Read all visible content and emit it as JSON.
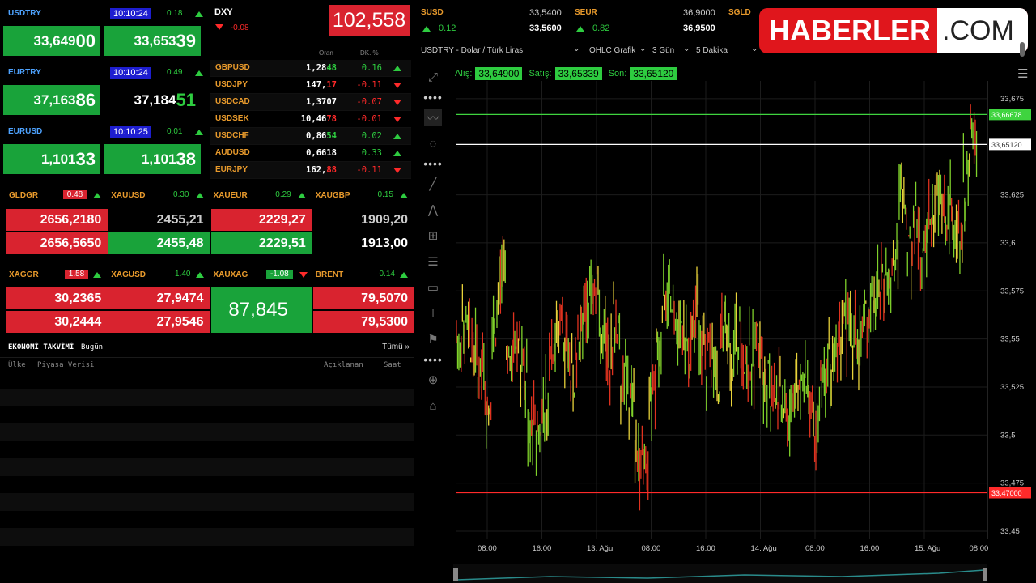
{
  "fx": [
    {
      "name": "USDTRY",
      "time": "10:10:24",
      "change": "0.18",
      "bid_big": "33,649",
      "bid_small": "00",
      "ask_big": "33,653",
      "ask_small": "39",
      "bid_color": "green",
      "ask_color": "green"
    },
    {
      "name": "EURTRY",
      "time": "10:10:24",
      "change": "0.49",
      "bid_big": "37,163",
      "bid_small": "86",
      "ask_big": "37,184",
      "ask_small": "51",
      "bid_color": "green",
      "ask_color": "black"
    },
    {
      "name": "EURUSD",
      "time": "10:10:25",
      "change": "0.01",
      "bid_big": "1,101",
      "bid_small": "33",
      "ask_big": "1,101",
      "ask_small": "38",
      "bid_color": "green",
      "ask_color": "green"
    }
  ],
  "dxy": {
    "name": "DXY",
    "change": "-0.08",
    "value": "102,558"
  },
  "quotes_header": {
    "rate": "Oran",
    "change": "DK. %"
  },
  "quotes": [
    {
      "name": "GBPUSD",
      "rate_a": "1,28",
      "rate_b": "48",
      "change": "0.16",
      "dir": "up"
    },
    {
      "name": "USDJPY",
      "rate_a": "147,",
      "rate_b": "17",
      "change": "-0.11",
      "dir": "dn"
    },
    {
      "name": "USDCAD",
      "rate_a": "1,3707",
      "rate_b": "",
      "change": "-0.07",
      "dir": "dn"
    },
    {
      "name": "USDSEK",
      "rate_a": "10,46",
      "rate_b": "78",
      "change": "-0.01",
      "dir": "dn"
    },
    {
      "name": "USDCHF",
      "rate_a": "0,86",
      "rate_b": "54",
      "change": "0.02",
      "dir": "up"
    },
    {
      "name": "AUDUSD",
      "rate_a": "0,6618",
      "rate_b": "",
      "change": "0.33",
      "dir": "up"
    },
    {
      "name": "EURJPY",
      "rate_a": "162,",
      "rate_b": "88",
      "change": "-0.11",
      "dir": "dn"
    }
  ],
  "metals_row1": [
    {
      "name": "GLDGR",
      "change": "0.48",
      "change_bg": "red",
      "top": "2656,2180",
      "bottom": "2656,5650",
      "top_color": "red",
      "bottom_color": "red"
    },
    {
      "name": "XAUUSD",
      "change": "0.30",
      "change_bg": "",
      "top": "2455,21",
      "bottom": "2455,48",
      "top_color": "black",
      "bottom_color": "green"
    },
    {
      "name": "XAUEUR",
      "change": "0.29",
      "change_bg": "",
      "top": "2229,27",
      "bottom": "2229,51",
      "top_color": "red",
      "bottom_color": "green"
    },
    {
      "name": "XAUGBP",
      "change": "0.15",
      "change_bg": "",
      "top": "1909,20",
      "bottom": "1913,00",
      "top_color": "black",
      "bottom_color": "black"
    }
  ],
  "metals_row2": [
    {
      "name": "XAGGR",
      "change": "1.58",
      "top": "30,2365",
      "bottom": "30,2444"
    },
    {
      "name": "XAGUSD",
      "change": "1.40",
      "top": "27,9474",
      "bottom": "27,9546"
    },
    {
      "name": "XAUXAG",
      "change": "-1.08",
      "single": "87,845"
    },
    {
      "name": "BRENT",
      "change": "0.14",
      "top": "79,5070",
      "bottom": "79,5300"
    }
  ],
  "calendar": {
    "title": "EKONOMİ TAKVİMİ",
    "sub": "Bugün",
    "all": "Tümü »",
    "col_country": "Ülke",
    "col_data": "Piyasa Verisi",
    "col_announced": "Açıklanan",
    "col_expected": "Saat"
  },
  "top_quotes": [
    {
      "name": "SUSD",
      "change": "0.12",
      "bid": "33,5400",
      "ask": "33,5600"
    },
    {
      "name": "SEUR",
      "change": "0.82",
      "bid": "36,9000",
      "ask": "36,9500"
    },
    {
      "name": "SGLD",
      "change": "",
      "bid": "",
      "ask": ""
    }
  ],
  "logo": {
    "main": "HABERLER",
    "suffix": ".COM"
  },
  "chart_toolbar": {
    "symbol": "USDTRY - Dolar / Türk Lirası",
    "type": "OHLC Grafik",
    "range": "3 Gün",
    "interval": "5 Dakika"
  },
  "chart_info": {
    "bid_label": "Alış:",
    "bid": "33,64900",
    "ask_label": "Satış:",
    "ask": "33,65339",
    "last_label": "Son:",
    "last": "33,65120"
  },
  "colors": {
    "up": "#2ecc40",
    "down": "#ff2a2a",
    "accent_blue": "#4ea3ff",
    "metal_orange": "#e89a2c"
  },
  "chart_data": {
    "type": "line",
    "title": "USDTRY - Dolar / Türk Lirası",
    "y_ticks": [
      "33,675",
      "33,65",
      "33,625",
      "33,6",
      "33,575",
      "33,55",
      "33,525",
      "33,5",
      "33,475",
      "33,45"
    ],
    "y_range": [
      33.45,
      33.68
    ],
    "x_ticks": [
      "08:00",
      "16:00",
      "13. Ağu",
      "08:00",
      "16:00",
      "14. Ağu",
      "08:00",
      "16:00",
      "15. Ağu",
      "08:00"
    ],
    "markers": [
      {
        "label": "33,66678",
        "value": 33.66678,
        "color": "#3fd43f"
      },
      {
        "label": "33,65120",
        "value": 33.6512,
        "color": "#ffffff"
      },
      {
        "label": "33,47000",
        "value": 33.47,
        "color": "#ff2a2a"
      }
    ],
    "series_approx": [
      33.55,
      33.56,
      33.54,
      33.53,
      33.52,
      33.56,
      33.58,
      33.54,
      33.55,
      33.53,
      33.51,
      33.5,
      33.52,
      33.55,
      33.56,
      33.54,
      33.53,
      33.55,
      33.57,
      33.58,
      33.55,
      33.54,
      33.56,
      33.53,
      33.52,
      33.49,
      33.48,
      33.52,
      33.55,
      33.57,
      33.56,
      33.55,
      33.54,
      33.56,
      33.55,
      33.54,
      33.53,
      33.55,
      33.54,
      33.55,
      33.54,
      33.54,
      33.55,
      33.53,
      33.52,
      33.52,
      33.51,
      33.52,
      33.53,
      33.52,
      33.51,
      33.52,
      33.54,
      33.55,
      33.56,
      33.55,
      33.55,
      33.56,
      33.57,
      33.58,
      33.58,
      33.6,
      33.62,
      33.6,
      33.61,
      33.6,
      33.61,
      33.62,
      33.61,
      33.62,
      33.61,
      33.63,
      33.65
    ]
  }
}
